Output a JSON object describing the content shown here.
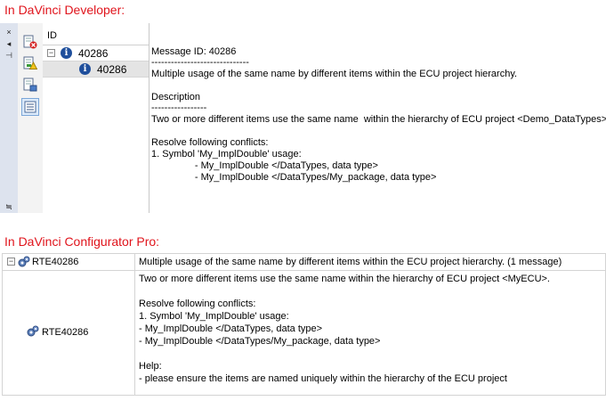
{
  "captions": {
    "developer": "In DaVinci Developer:",
    "configurator": "In DaVinci Configurator Pro:"
  },
  "developer": {
    "strip_glyphs": [
      "×",
      "◂",
      "⊣",
      "≒"
    ],
    "toolbar_icons": [
      "report-error-icon",
      "report-warning-icon",
      "report-check-icon",
      "message-list-icon"
    ],
    "tree": {
      "column_header": "ID",
      "parent": {
        "expander": "−",
        "label": "40286",
        "icon": "info-icon"
      },
      "child": {
        "label": "40286",
        "icon": "info-icon"
      }
    },
    "detail": {
      "lines": [
        "Message ID: 40286",
        "------------------------------",
        "Multiple usage of the same name by different items within the ECU project hierarchy.",
        "",
        "Description",
        "-----------------",
        "Two or more different items use the same name  within the hierarchy of ECU project <Demo_DataTypes>.",
        "",
        "Resolve following conflicts:",
        "1. Symbol 'My_ImplDouble' usage:",
        "                - My_ImplDouble </DataTypes, data type>",
        "                - My_ImplDouble </DataTypes/My_package, data type>"
      ]
    }
  },
  "configurator": {
    "row": {
      "expander": "−",
      "id": "RTE40286",
      "icon": "gears-icon",
      "summary": "Multiple usage of the same name by different items within the ECU project hierarchy. (1 message)"
    },
    "child": {
      "id": "RTE40286",
      "icon": "gears-icon",
      "lines": [
        "Two or more different items use the same name within the hierarchy of ECU project <MyECU>.",
        "",
        "Resolve following conflicts:",
        "1. Symbol 'My_ImplDouble' usage:",
        "- My_ImplDouble </DataTypes, data type>",
        "- My_ImplDouble </DataTypes/My_package, data type>",
        "",
        "Help:",
        "- please ensure the items are named uniquely within the hierarchy of the ECU project"
      ]
    }
  }
}
